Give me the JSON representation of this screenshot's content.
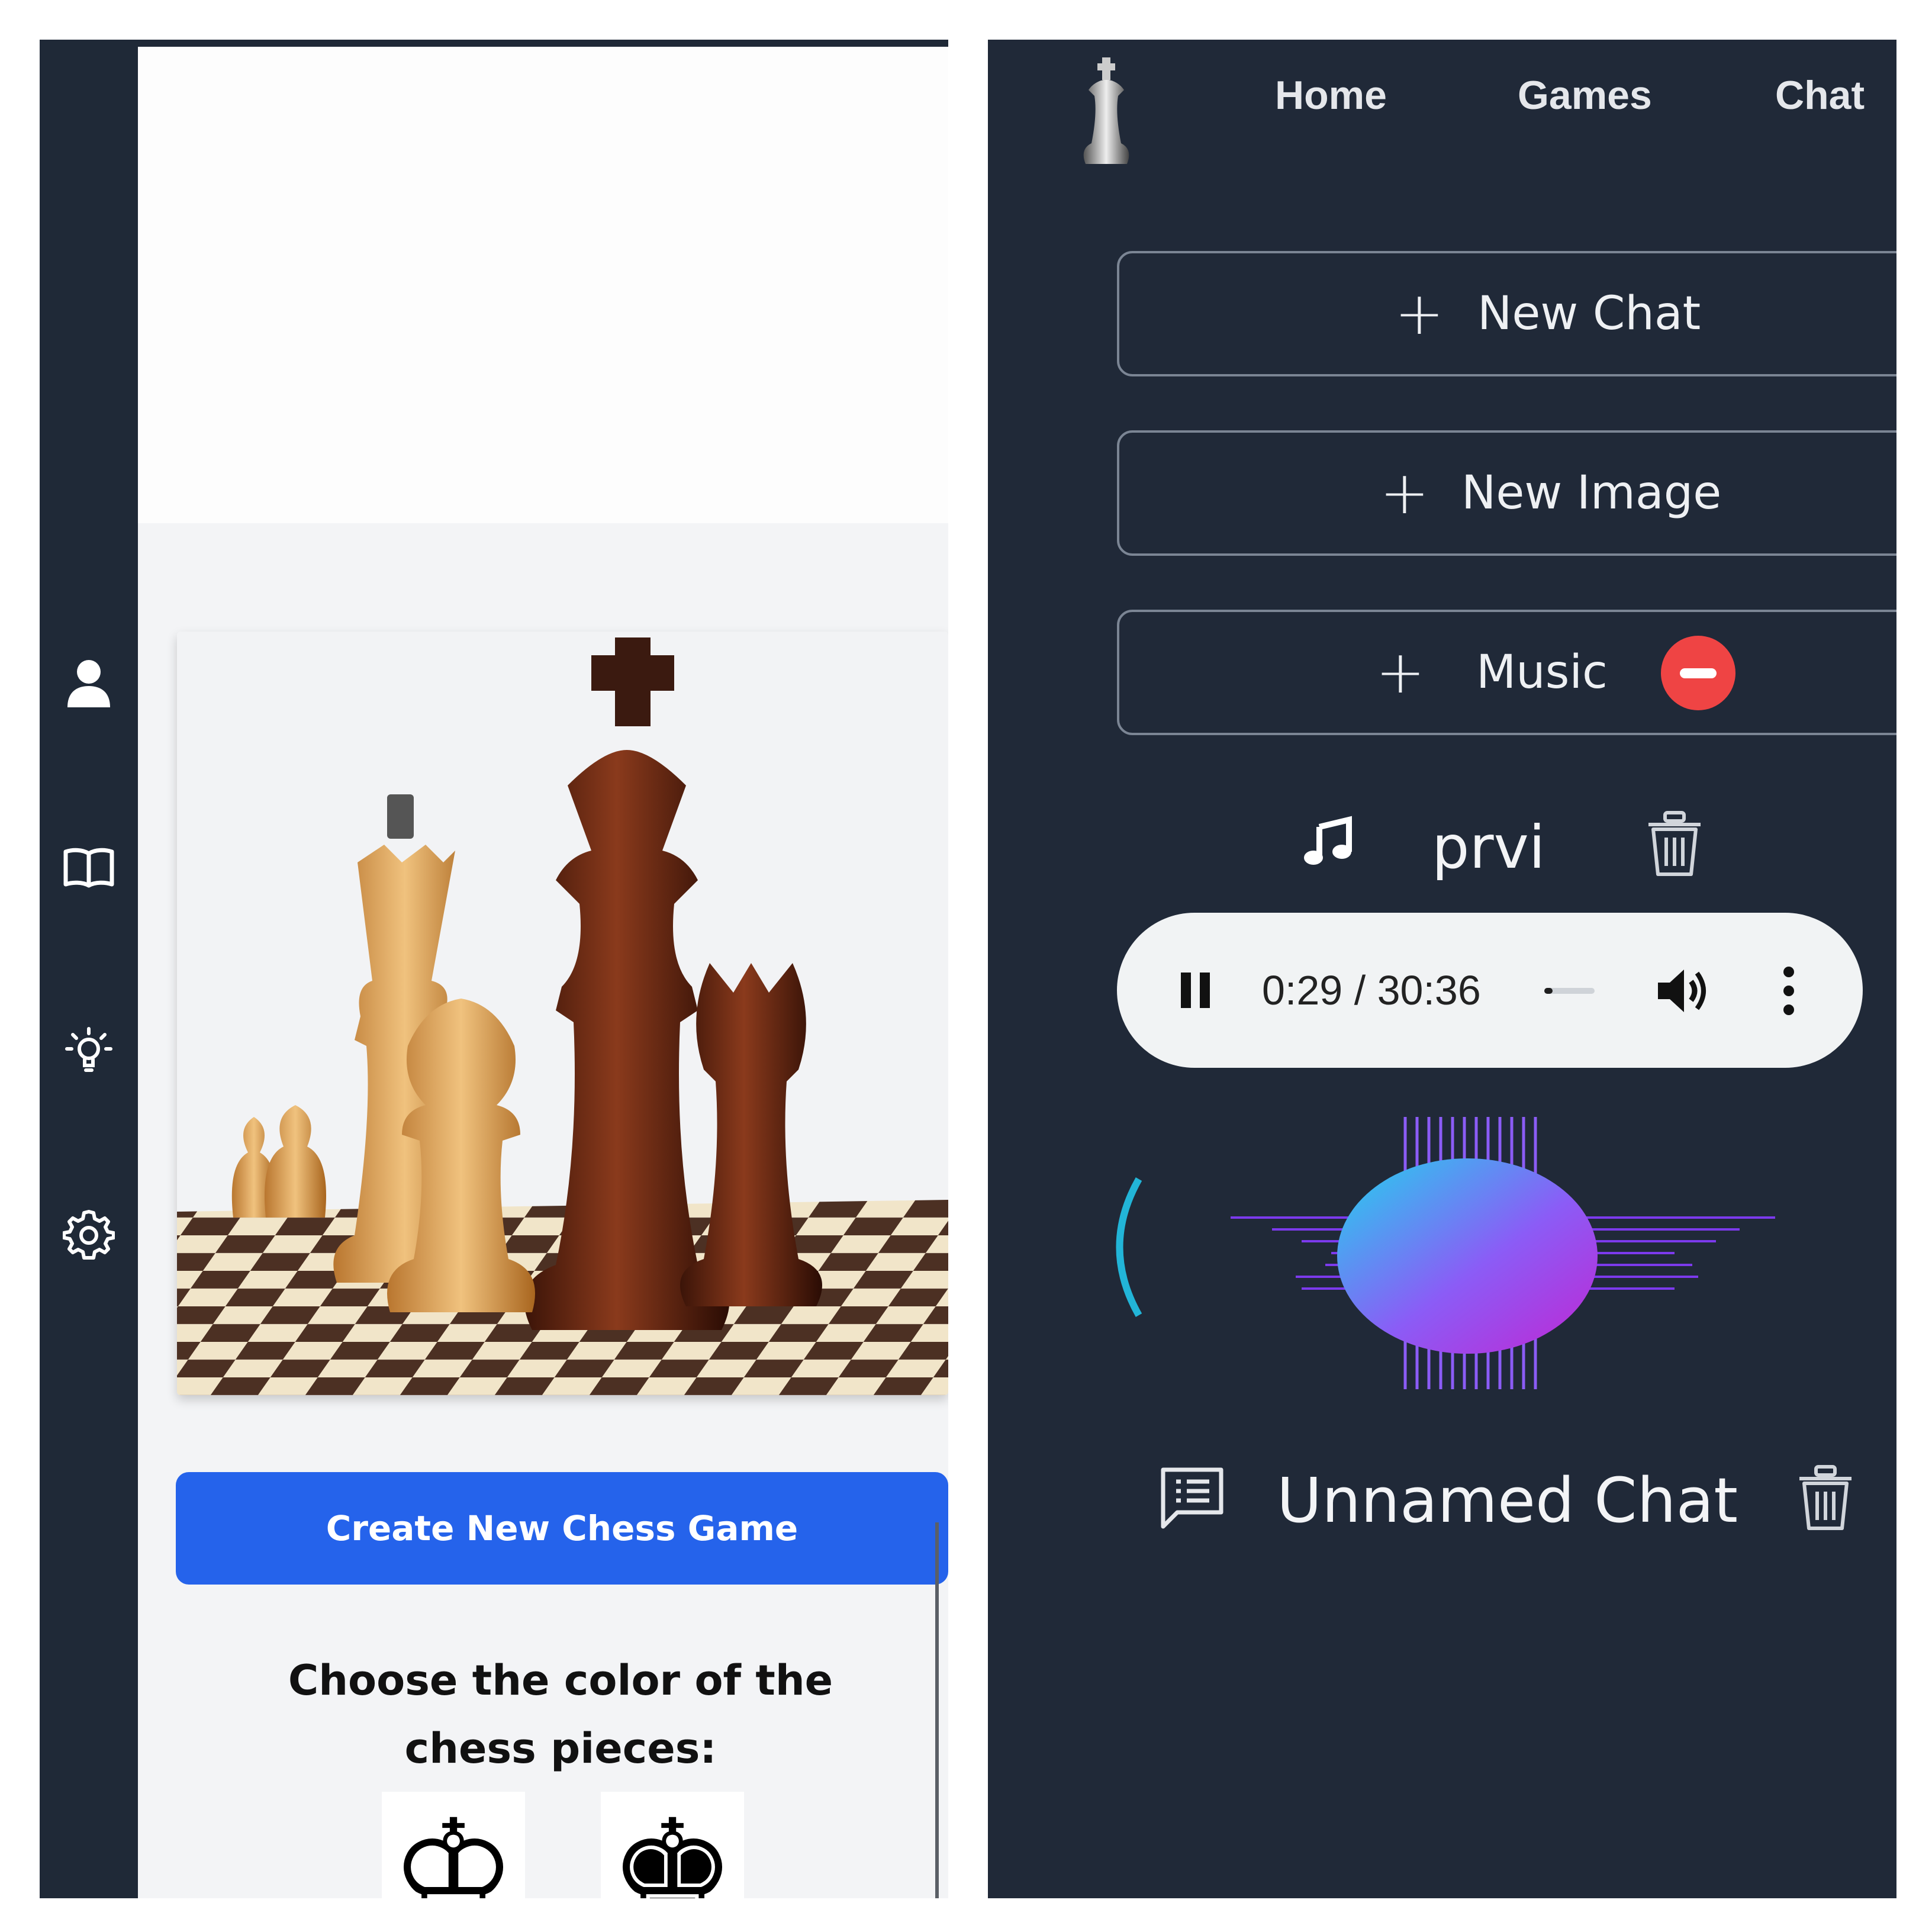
{
  "colors": {
    "sidebar_bg": "#1f2937",
    "right_panel_bg": "#202938",
    "primary_button": "#2563eb",
    "danger": "#ef4444",
    "content_bg": "#f3f4f6"
  },
  "left": {
    "sidebar_icons": [
      "user-icon",
      "book-icon",
      "lightbulb-icon",
      "settings-icon"
    ],
    "create_game_label": "Create New Chess Game",
    "choose_color_text": "Choose the color of the chess pieces:",
    "color_options": [
      {
        "name": "white-king",
        "glyph": "♔"
      },
      {
        "name": "black-king",
        "glyph": "♚"
      }
    ]
  },
  "right": {
    "nav": {
      "logo": "chess-king-logo",
      "links": [
        "Home",
        "Games",
        "Chat"
      ]
    },
    "actions": [
      {
        "label": "New Chat",
        "icon": "plus-icon"
      },
      {
        "label": "New Image",
        "icon": "plus-icon"
      },
      {
        "label": "Music",
        "icon": "plus-icon",
        "badge": "remove-icon"
      }
    ],
    "music_item": {
      "title": "prvi",
      "icon": "music-note-icon",
      "delete_icon": "trash-icon"
    },
    "player": {
      "state": "playing",
      "time": "0:29 / 30:36",
      "progress": 0.016
    },
    "chat_item": {
      "title": "Unnamed Chat",
      "icon": "chat-list-icon",
      "delete_icon": "trash-icon"
    }
  }
}
